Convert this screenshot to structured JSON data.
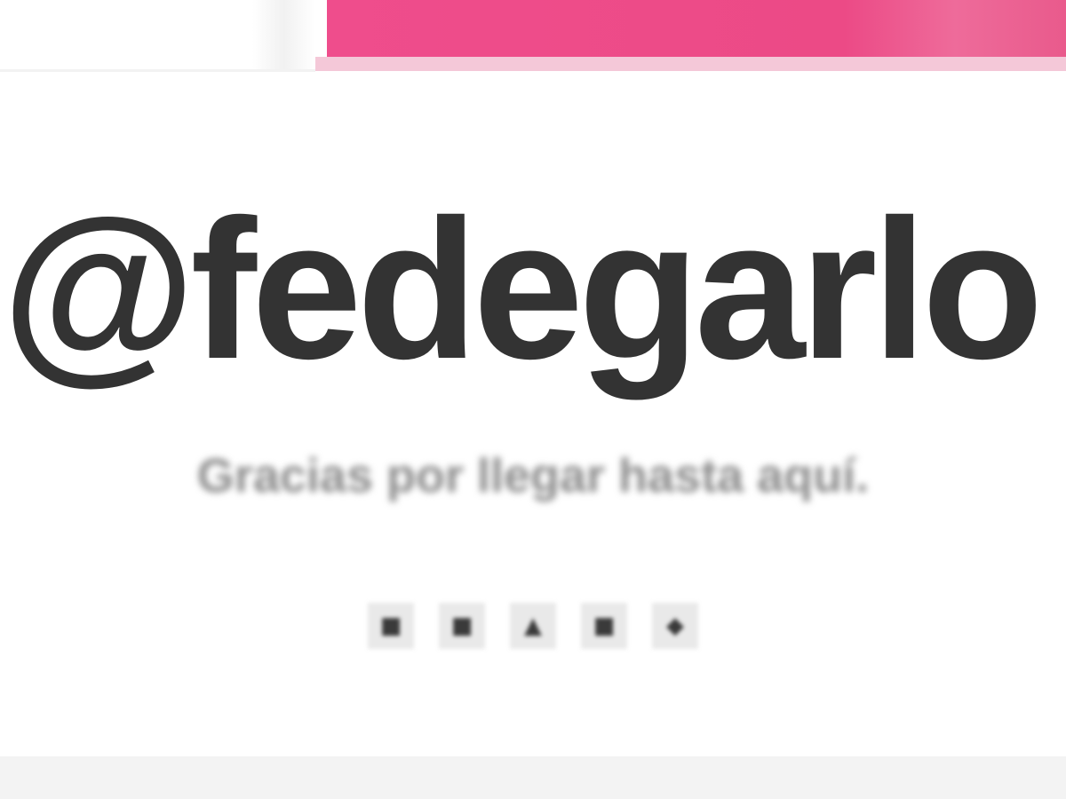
{
  "header": {
    "accent_color": "#ec4a86"
  },
  "profile": {
    "handle": "@fedegarlo",
    "tagline": "Gracias por llegar hasta aquí."
  },
  "social": {
    "icons": [
      {
        "name": "twitter-icon",
        "glyph": "■"
      },
      {
        "name": "github-icon",
        "glyph": "■"
      },
      {
        "name": "linkedin-icon",
        "glyph": "▲"
      },
      {
        "name": "email-icon",
        "glyph": "■"
      },
      {
        "name": "instagram-icon",
        "glyph": "◆"
      }
    ]
  }
}
